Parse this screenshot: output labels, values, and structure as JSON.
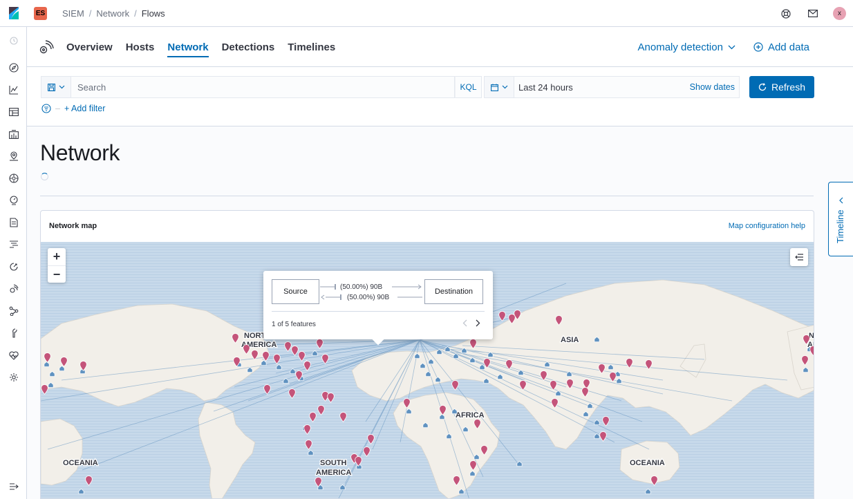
{
  "header": {
    "space_badge": "ES",
    "breadcrumbs": [
      "SIEM",
      "Network",
      "Flows"
    ],
    "avatar_initial": "x"
  },
  "subnav": {
    "tabs": [
      {
        "label": "Overview",
        "selected": false
      },
      {
        "label": "Hosts",
        "selected": false
      },
      {
        "label": "Network",
        "selected": true
      },
      {
        "label": "Detections",
        "selected": false
      },
      {
        "label": "Timelines",
        "selected": false
      }
    ],
    "anomaly_label": "Anomaly detection",
    "add_data_label": "Add data"
  },
  "query": {
    "search_placeholder": "Search",
    "language": "KQL",
    "date_range": "Last 24 hours",
    "show_dates": "Show dates",
    "refresh_label": "Refresh",
    "add_filter": "+ Add filter"
  },
  "page": {
    "title": "Network"
  },
  "map_panel": {
    "title": "Network map",
    "help_link": "Map configuration help",
    "zoom_in": "+",
    "zoom_out": "−",
    "tooltip": {
      "source": "Source",
      "destination": "Destination",
      "outbound": "(50.00%)  90B",
      "inbound": "(50.00%)  90B",
      "features": "1 of 5 features"
    },
    "regions": {
      "north_america_1": "NORT",
      "north_america_2": "AMERICA",
      "asia": "ASIA",
      "africa": "AFRICA",
      "south_america_1": "SOUTH",
      "south_america_2": "AMERICA",
      "oceania_left": "OCEANIA",
      "oceania_right": "OCEANIA",
      "na_right_1": "N",
      "na_right_2": "AI"
    }
  },
  "timeline": {
    "label": "Timeline"
  },
  "colors": {
    "accent": "#006bb4",
    "ocean": "#c6d9ea",
    "land": "#f2efe9",
    "destination_pin": "#c4547a",
    "source_pin": "#6092c0"
  }
}
